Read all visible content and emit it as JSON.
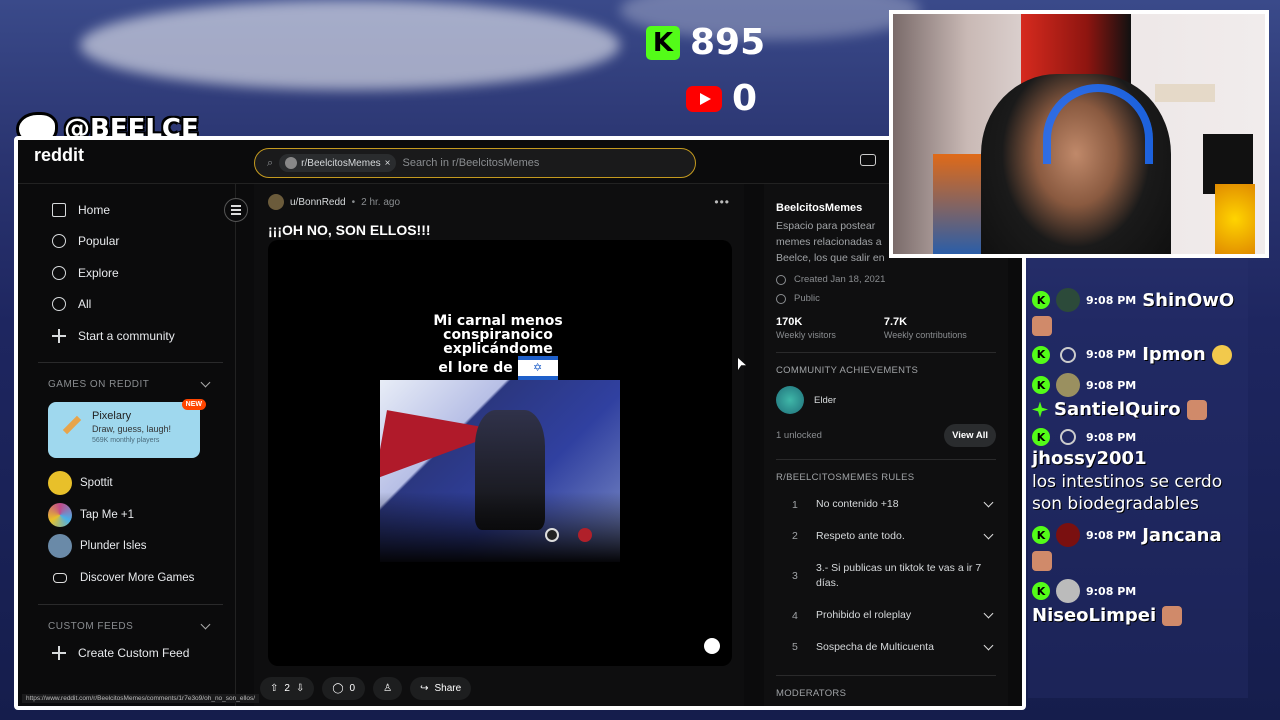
{
  "overlay": {
    "kick_count": "895",
    "youtube_count": "0",
    "twitter_handle": "@BEELCE_",
    "kick_icon": "kick-logo",
    "youtube_icon": "youtube-logo",
    "twitter_icon": "twitter-bird"
  },
  "reddit": {
    "logo_text": "reddit",
    "search": {
      "chip_label": "r/BeelcitosMemes",
      "chip_close": "×",
      "placeholder": "Search in r/BeelcitosMemes"
    },
    "nav": [
      {
        "label": "Home",
        "icon": "home-icon"
      },
      {
        "label": "Popular",
        "icon": "popular-icon"
      },
      {
        "label": "Explore",
        "icon": "explore-icon"
      },
      {
        "label": "All",
        "icon": "all-icon"
      },
      {
        "label": "Start a community",
        "icon": "plus-icon"
      }
    ],
    "games_header": "GAMES ON REDDIT",
    "pixelary": {
      "title": "Pixelary",
      "subtitle": "Draw, guess, laugh!",
      "players": "569K monthly players",
      "badge": "NEW"
    },
    "games": [
      {
        "label": "Spottit",
        "color": "#e8c02a"
      },
      {
        "label": "Tap Me +1",
        "color": "#c24a8a"
      },
      {
        "label": "Plunder Isles",
        "color": "#6a8aa8"
      },
      {
        "label": "Discover More Games",
        "color": ""
      }
    ],
    "custom_feeds_header": "CUSTOM FEEDS",
    "create_feed": "Create Custom Feed",
    "status_url": "https://www.reddit.com/r/BeelcitosMemes/comments/1r7e3o9/oh_no_son_ellos/",
    "post": {
      "author": "u/BonnRedd",
      "separator": "•",
      "time": "2 hr. ago",
      "more": "•••",
      "title": "¡¡¡OH NO, SON ELLOS!!!",
      "meme_line1": "Mi carnal menos",
      "meme_line2": "conspiranoico",
      "meme_line3": "explicándome",
      "meme_line4": "el lore de",
      "flag_symbol": "✡",
      "votes": "2",
      "comments": "0",
      "share": "Share"
    },
    "sidebar": {
      "name": "BeelcitosMemes",
      "description": "Espacio para postear memes relacionadas a Beelce, los que salir en Stream!",
      "created": "Created Jan 18, 2021",
      "visibility": "Public",
      "weekly_visitors_value": "170K",
      "weekly_visitors_label": "Weekly visitors",
      "weekly_contrib_value": "7.7K",
      "weekly_contrib_label": "Weekly contributions",
      "achievements_header": "COMMUNITY ACHIEVEMENTS",
      "achievement": "Elder",
      "unlocked": "1 unlocked",
      "view_all": "View All",
      "rules_header": "R/BEELCITOSMEMES RULES",
      "rules": [
        {
          "n": "1",
          "text": "No contenido +18"
        },
        {
          "n": "2",
          "text": "Respeto ante todo."
        },
        {
          "n": "3",
          "text": "3.- Si publicas un tiktok te vas a ir 7 días."
        },
        {
          "n": "4",
          "text": "Prohibido el roleplay"
        },
        {
          "n": "5",
          "text": "Sospecha de Multicuenta"
        }
      ],
      "moderators_header": "MODERATORS"
    }
  },
  "chat": {
    "messages": [
      {
        "time": "9:08 PM",
        "user": "ShinOwO",
        "text": "",
        "emote": "face-emote"
      },
      {
        "time": "9:08 PM",
        "user": "Ipmon",
        "text": "",
        "emote": "smile-emote"
      },
      {
        "time": "9:08 PM",
        "user": "SantielQuiro",
        "text": "",
        "emote": "face-emote"
      },
      {
        "time": "9:08 PM",
        "user": "jhossy2001",
        "text": "los intestinos se cerdo son biodegradables",
        "emote": ""
      },
      {
        "time": "9:08 PM",
        "user": "Jancana",
        "text": "",
        "emote": "face-emote"
      },
      {
        "time": "9:08 PM",
        "user": "NiseoLimpei",
        "text": "",
        "emote": "face-emote"
      }
    ]
  },
  "colors": {
    "kick_green": "#53fc18",
    "youtube_red": "#ff0000",
    "reddit_bg": "#0b0b0c",
    "search_border": "#c49a1f",
    "new_badge": "#ff4500"
  }
}
